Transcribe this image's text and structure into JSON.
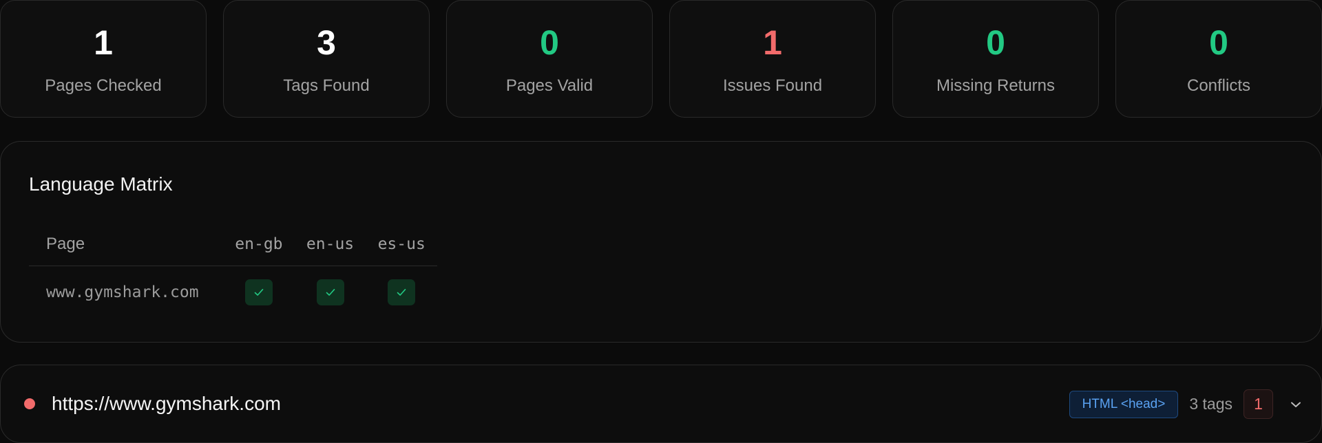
{
  "stats": [
    {
      "value": "1",
      "label": "Pages Checked",
      "tone": "white"
    },
    {
      "value": "3",
      "label": "Tags Found",
      "tone": "white"
    },
    {
      "value": "0",
      "label": "Pages Valid",
      "tone": "green"
    },
    {
      "value": "1",
      "label": "Issues Found",
      "tone": "red"
    },
    {
      "value": "0",
      "label": "Missing Returns",
      "tone": "green"
    },
    {
      "value": "0",
      "label": "Conflicts",
      "tone": "green"
    }
  ],
  "matrix": {
    "title": "Language Matrix",
    "page_header": "Page",
    "languages": [
      "en-gb",
      "en-us",
      "es-us"
    ],
    "rows": [
      {
        "page": "www.gymshark.com",
        "cells": [
          "check",
          "check",
          "check"
        ]
      }
    ]
  },
  "result": {
    "url": "https://www.gymshark.com",
    "status": "error",
    "source_badge": "HTML <head>",
    "tags_count": "3 tags",
    "issues_count": "1"
  },
  "colors": {
    "background": "#0b0b0b",
    "green": "#22c983",
    "red": "#f26b6b",
    "blue": "#5aa2f2"
  },
  "icons": {
    "check": "check-icon",
    "expand": "chevron-down-icon",
    "status": "status-dot"
  }
}
